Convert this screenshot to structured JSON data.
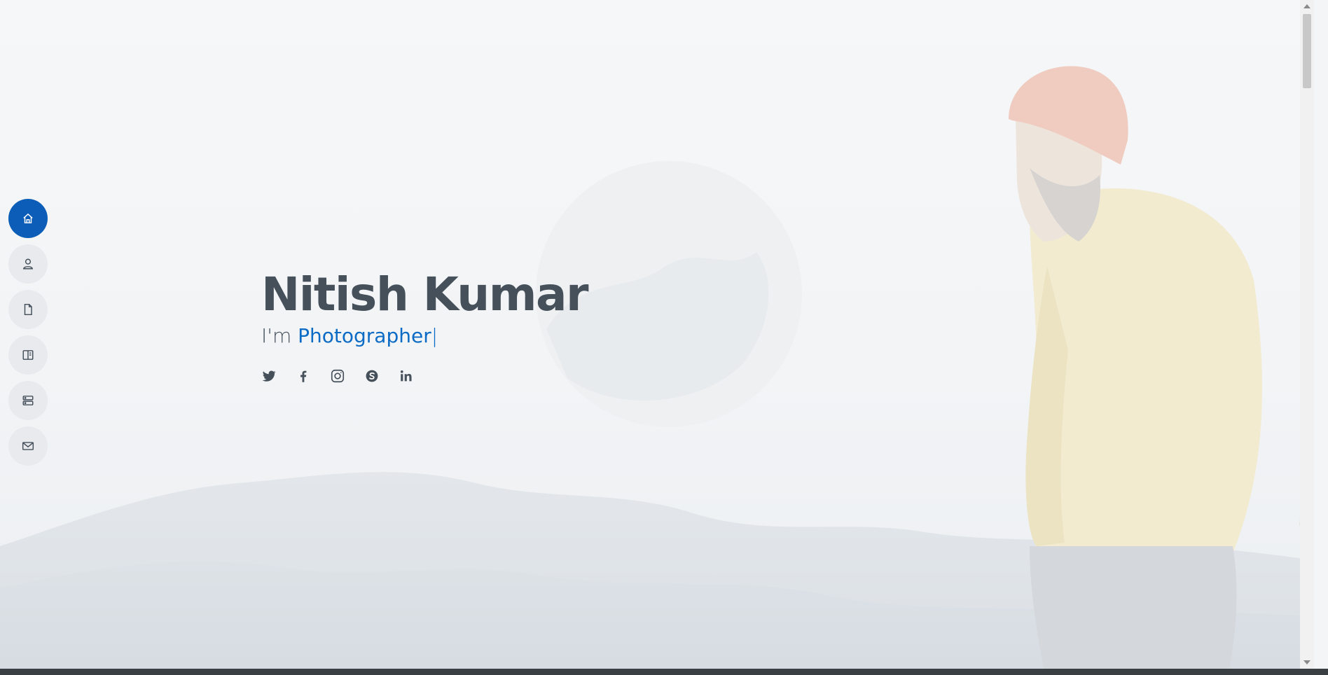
{
  "hero": {
    "name": "Nitish Kumar",
    "tagline_prefix": "I'm ",
    "typed_text": "Photographer",
    "caret": "|"
  },
  "nav": {
    "items": [
      {
        "name": "home",
        "icon": "home-icon",
        "active": true
      },
      {
        "name": "about",
        "icon": "person-icon",
        "active": false
      },
      {
        "name": "resume",
        "icon": "file-icon",
        "active": false
      },
      {
        "name": "portfolio",
        "icon": "book-half-icon",
        "active": false
      },
      {
        "name": "services",
        "icon": "server-icon",
        "active": false
      },
      {
        "name": "contact",
        "icon": "envelope-icon",
        "active": false
      }
    ]
  },
  "social": {
    "links": [
      {
        "name": "twitter",
        "icon": "twitter-icon"
      },
      {
        "name": "facebook",
        "icon": "facebook-icon"
      },
      {
        "name": "instagram",
        "icon": "instagram-icon"
      },
      {
        "name": "skype",
        "icon": "skype-icon"
      },
      {
        "name": "linkedin",
        "icon": "linkedin-icon"
      }
    ]
  },
  "colors": {
    "accent": "#0c5db8",
    "typed": "#0c6bc4",
    "text": "#45505b",
    "nav_bg": "#e8eaed",
    "icon": "#45505b"
  }
}
